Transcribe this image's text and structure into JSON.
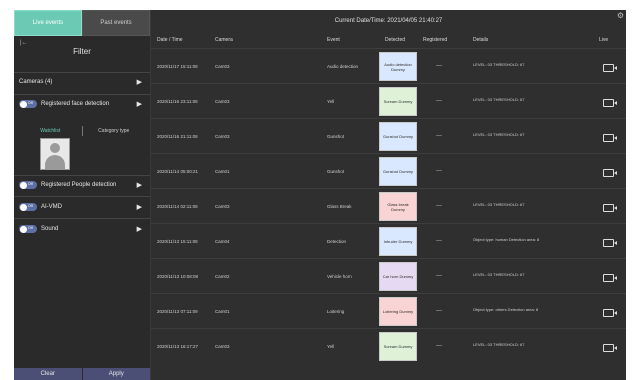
{
  "tabs": {
    "live": "Live events",
    "past": "Past events"
  },
  "sidebar": {
    "collapse_glyph": "|←",
    "filter_title": "Filter",
    "cameras_label": "Cameras (4)",
    "toggle_text": "Off",
    "face_detection_label": "Registered face detection",
    "watchlist_tab": "Watchlist",
    "category_tab": "Category type",
    "people_detection_label": "Registered People detection",
    "aivmd_label": "AI-VMD",
    "sound_label": "Sound",
    "arrow": "▶",
    "clear_label": "Clear",
    "apply_label": "Apply"
  },
  "topbar": {
    "datetime": "Current Date/Time:  2021/04/05 21:40:27",
    "gear": "⚙"
  },
  "columns": [
    "Date / Time",
    "Camera",
    "Event",
    "Detected",
    "Registered",
    "Details",
    "Live"
  ],
  "rows": [
    {
      "datetime": "2020/11/17 15:11:08",
      "camera": "Cam03",
      "event": "Audio detection",
      "detected": "Audio detection Dummy",
      "registered": "—",
      "details": "LEVEL: 03 THRESHOLD: 67",
      "color": "#d9e8ff"
    },
    {
      "datetime": "2020/11/16 23:11:08",
      "camera": "Cam03",
      "event": "Yell",
      "detected": "Scream Dummy",
      "registered": "—",
      "details": "LEVEL: 03 THRESHOLD: 67",
      "color": "#dff2d8"
    },
    {
      "datetime": "2020/11/16 21:11:08",
      "camera": "Cam03",
      "event": "Gunshot",
      "detected": "Gunshot Dummy",
      "registered": "—",
      "details": "LEVEL: 03 THRESHOLD: 67",
      "color": "#d9e8ff"
    },
    {
      "datetime": "2020/11/14 05:00:21",
      "camera": "Cam01",
      "event": "Gunshot",
      "detected": "Gunshot Dummy",
      "registered": "—",
      "details": "",
      "color": "#d9e8ff"
    },
    {
      "datetime": "2020/11/14 02:11:08",
      "camera": "Cam03",
      "event": "Glass Break",
      "detected": "Glass break Dummy",
      "registered": "—",
      "details": "LEVEL: 03 THRESHOLD: 67",
      "color": "#f9d4d4"
    },
    {
      "datetime": "2020/11/13 15:11:08",
      "camera": "Cam04",
      "event": "Detection",
      "detected": "Intruder Dummy",
      "registered": "—",
      "details": "Object type: human Detection area: 8",
      "color": "#d9e8ff"
    },
    {
      "datetime": "2020/11/13 10:08:08",
      "camera": "Cam02",
      "event": "Vehicle horn",
      "detected": "Car horn Dummy",
      "registered": "—",
      "details": "LEVEL: 03 THRESHOLD: 67",
      "color": "#e6d9f2"
    },
    {
      "datetime": "2020/11/13 07:11:09",
      "camera": "Cam01",
      "event": "Loitering",
      "detected": "Loitering Dummy",
      "registered": "—",
      "details": "Object type: others Detection area: 8",
      "color": "#f9d4d4"
    },
    {
      "datetime": "2020/11/13 16:17:27",
      "camera": "Cam03",
      "event": "Yell",
      "detected": "Scream Dummy",
      "registered": "—",
      "details": "LEVEL: 03 THRESHOLD: 67",
      "color": "#dff2d8"
    }
  ]
}
